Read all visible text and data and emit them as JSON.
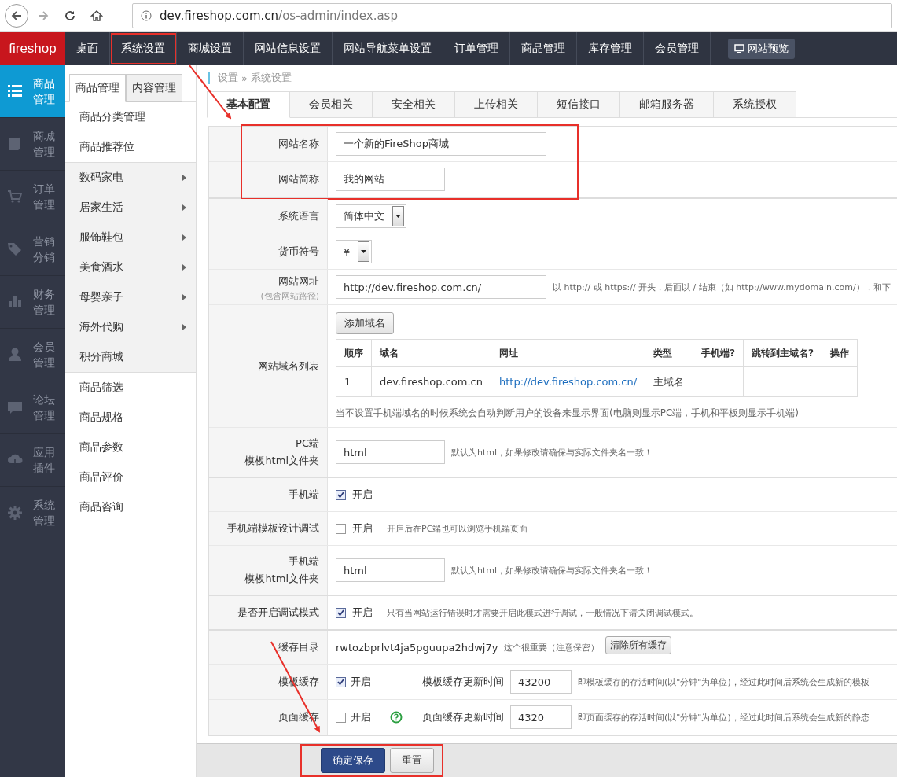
{
  "browser": {
    "url_host": "dev.fireshop.com.cn",
    "url_path": "/os-admin/index.asp"
  },
  "topnav": {
    "logo": "fireshop",
    "items": [
      {
        "label": "桌面",
        "highlighted": false
      },
      {
        "label": "系统设置",
        "highlighted": true
      },
      {
        "label": "商城设置",
        "highlighted": false
      },
      {
        "label": "网站信息设置",
        "highlighted": false
      },
      {
        "label": "网站导航菜单设置",
        "highlighted": false
      },
      {
        "label": "订单管理",
        "highlighted": false
      },
      {
        "label": "商品管理",
        "highlighted": false
      },
      {
        "label": "库存管理",
        "highlighted": false
      },
      {
        "label": "会员管理",
        "highlighted": false
      }
    ],
    "preview_button": "网站预览"
  },
  "sidebar": {
    "items": [
      {
        "label": "商品管理",
        "selected": true
      },
      {
        "label": "商城管理",
        "selected": false
      },
      {
        "label": "订单管理",
        "selected": false
      },
      {
        "label": "营销分销",
        "selected": false
      },
      {
        "label": "财务管理",
        "selected": false
      },
      {
        "label": "会员管理",
        "selected": false
      },
      {
        "label": "论坛管理",
        "selected": false
      },
      {
        "label": "应用插件",
        "selected": false
      },
      {
        "label": "系统管理",
        "selected": false
      }
    ]
  },
  "subnav": {
    "tabs": [
      {
        "label": "商品管理",
        "selected": true
      },
      {
        "label": "内容管理",
        "selected": false
      }
    ],
    "groups": [
      {
        "shaded": false,
        "items": [
          {
            "label": "商品分类管理",
            "submenu": false
          },
          {
            "label": "商品推荐位",
            "submenu": false
          }
        ]
      },
      {
        "shaded": true,
        "items": [
          {
            "label": "数码家电",
            "submenu": true
          },
          {
            "label": "居家生活",
            "submenu": true
          },
          {
            "label": "服饰鞋包",
            "submenu": true
          },
          {
            "label": "美食酒水",
            "submenu": true
          },
          {
            "label": "母婴亲子",
            "submenu": true
          },
          {
            "label": "海外代购",
            "submenu": true
          },
          {
            "label": "积分商城",
            "submenu": false
          }
        ]
      },
      {
        "shaded": false,
        "items": [
          {
            "label": "商品筛选",
            "submenu": false
          },
          {
            "label": "商品规格",
            "submenu": false
          },
          {
            "label": "商品参数",
            "submenu": false
          },
          {
            "label": "商品评价",
            "submenu": false
          },
          {
            "label": "商品咨询",
            "submenu": false
          }
        ]
      }
    ]
  },
  "breadcrumb": [
    "设置",
    "»",
    "系统设置"
  ],
  "tabs": [
    {
      "label": "基本配置",
      "selected": true
    },
    {
      "label": "会员相关",
      "selected": false
    },
    {
      "label": "安全相关",
      "selected": false
    },
    {
      "label": "上传相关",
      "selected": false
    },
    {
      "label": "短信接口",
      "selected": false
    },
    {
      "label": "邮箱服务器",
      "selected": false
    },
    {
      "label": "系统授权",
      "selected": false
    }
  ],
  "sections": [
    {
      "highlighted": true,
      "rows": [
        {
          "kind": "long_input",
          "label": [
            "网站名称"
          ],
          "value": "一个新的FireShop商城"
        },
        {
          "kind": "input",
          "label": [
            "网站简称"
          ],
          "value": "我的网站"
        }
      ]
    },
    {
      "rows": [
        {
          "kind": "select",
          "label": [
            "系统语言"
          ],
          "value": "简体中文"
        },
        {
          "kind": "select",
          "label": [
            "货币符号"
          ],
          "value": "¥"
        },
        {
          "kind": "long_input",
          "label": [
            "网站网址"
          ],
          "sublabel": "(包含网站路径)",
          "value": "http://dev.fireshop.com.cn/",
          "hint": "以 http:// 或 https:// 开头，后面以 / 结束（如 http://www.mydomain.com/），和下"
        },
        {
          "kind": "domains",
          "label": [
            "网站域名列表"
          ],
          "button": "添加域名",
          "columns": [
            "顺序",
            "域名",
            "网址",
            "类型",
            "手机端?",
            "跳转到主域名?",
            "操作"
          ],
          "rows": [
            {
              "order": "1",
              "domain": "dev.fireshop.com.cn",
              "url": "http://dev.fireshop.com.cn/",
              "type": "主域名"
            }
          ],
          "note": "当不设置手机端域名的时候系统会自动判断用户的设备来显示界面(电脑则显示PC端，手机和平板则显示手机端)"
        },
        {
          "kind": "input",
          "label": [
            "PC端",
            "模板html文件夹"
          ],
          "value": "html",
          "hint": "默认为html，如果修改请确保与实际文件夹名一致！"
        }
      ]
    },
    {
      "rows": [
        {
          "kind": "checkbox",
          "label": [
            "手机端"
          ],
          "checked": true,
          "text": "开启"
        },
        {
          "kind": "checkbox",
          "label": [
            "手机端模板设计调试"
          ],
          "checked": false,
          "text": "开启",
          "hint": "开启后在PC端也可以浏览手机端页面"
        },
        {
          "kind": "input",
          "label": [
            "手机端",
            "模板html文件夹"
          ],
          "value": "html",
          "hint": "默认为html，如果修改请确保与实际文件夹名一致！"
        }
      ]
    },
    {
      "rows": [
        {
          "kind": "checkbox",
          "label": [
            "是否开启调试模式"
          ],
          "checked": true,
          "text": "开启",
          "hint": "只有当网站运行错误时才需要开启此模式进行调试，一般情况下请关闭调试模式。"
        }
      ]
    },
    {
      "rows": [
        {
          "kind": "cachedir",
          "label": [
            "缓存目录"
          ],
          "value": "rwtozbprlvt4ja5pguupa2hdwj7y",
          "note": "这个很重要（注意保密）",
          "button": "清除所有缓存"
        },
        {
          "kind": "cache",
          "label": [
            "模板缓存"
          ],
          "checked": true,
          "text": "开启",
          "time_label": "模板缓存更新时间",
          "value": "43200",
          "hint": "即模板缓存的存活时间(以\"分钟\"为单位)，经过此时间后系统会生成新的模板"
        },
        {
          "kind": "cache_help",
          "label": [
            "页面缓存"
          ],
          "checked": false,
          "text": "开启",
          "time_label": "页面缓存更新时间",
          "value": "4320",
          "hint": "即页面缓存的存活时间(以\"分钟\"为单位)，经过此时间后系统会生成新的静态"
        }
      ]
    }
  ],
  "footer": {
    "highlighted": true,
    "buttons": [
      {
        "kind": "primary",
        "label": "确定保存"
      },
      {
        "kind": "default",
        "label": "重置"
      }
    ]
  }
}
